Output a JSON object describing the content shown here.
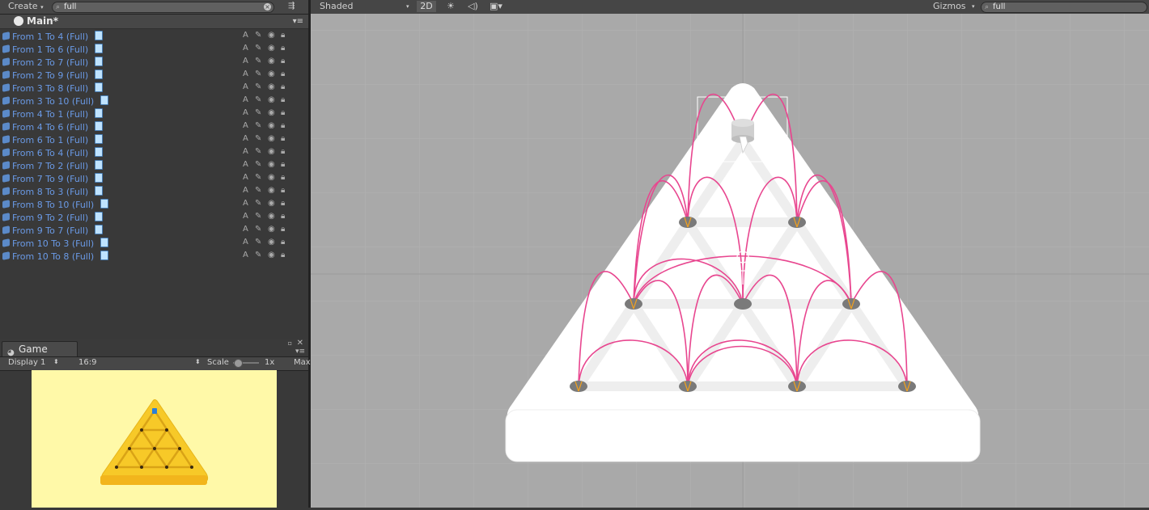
{
  "hierarchy": {
    "create_label": "Create",
    "search_value": "full",
    "scene_name": "Main*",
    "items": [
      "From 1 To 4 (Full)",
      "From 1 To 6 (Full)",
      "From 2 To 7 (Full)",
      "From 2 To 9 (Full)",
      "From 3 To 8 (Full)",
      "From 3 To 10 (Full)",
      "From 4 To 1 (Full)",
      "From 4 To 6 (Full)",
      "From 6 To 1 (Full)",
      "From 6 To 4 (Full)",
      "From 7 To 2 (Full)",
      "From 7 To 9 (Full)",
      "From 8 To 3 (Full)",
      "From 8 To 10 (Full)",
      "From 9 To 2 (Full)",
      "From 9 To 7 (Full)",
      "From 10 To 3 (Full)",
      "From 10 To 8 (Full)"
    ],
    "row_icon_label": "A"
  },
  "game": {
    "tab_label": "Game",
    "display_label": "Display 1",
    "aspect_label": "16:9",
    "scale_label": "Scale",
    "scale_value": "1x",
    "max_label": "Max",
    "background_color": "#fff9a8",
    "board_color": "#f7c928"
  },
  "scene": {
    "shading_mode": "Shaded",
    "mode_2d": "2D",
    "gizmos_label": "Gizmos",
    "search_value": "full",
    "background_color": "#a9a9a9",
    "arc_color": "#e8468f",
    "board_color": "#ffffff"
  }
}
